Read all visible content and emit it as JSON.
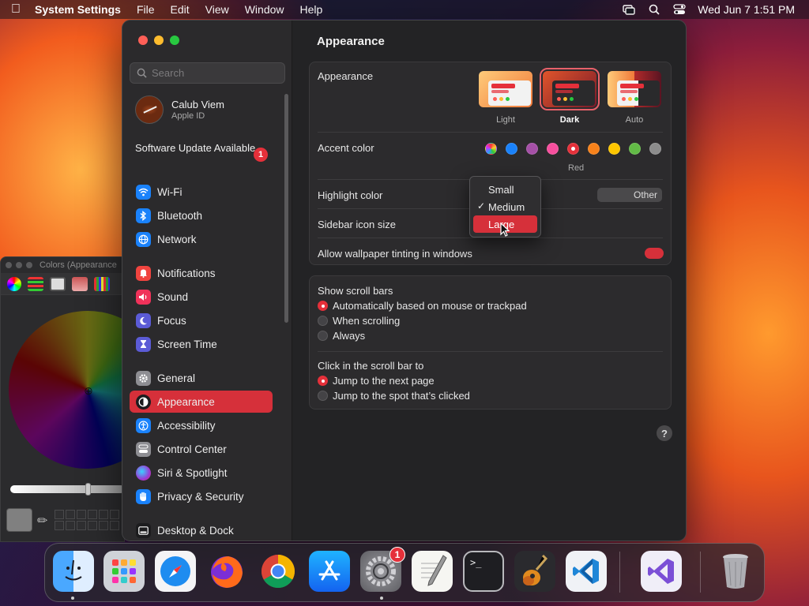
{
  "menubar": {
    "app_name": "System Settings",
    "items": [
      "File",
      "Edit",
      "View",
      "Window",
      "Help"
    ],
    "clock": "Wed Jun 7  1:51 PM"
  },
  "colors_panel": {
    "title": "Colors (Appearance"
  },
  "sidebar": {
    "search_placeholder": "Search",
    "account": {
      "name": "Calub Viem",
      "subtitle": "Apple ID"
    },
    "update": {
      "label": "Software Update Available",
      "badge": "1"
    },
    "items": [
      {
        "label": "Wi-Fi",
        "icon": "wifi-icon",
        "color": "#1a82fb"
      },
      {
        "label": "Bluetooth",
        "icon": "bluetooth-icon",
        "color": "#1a82fb"
      },
      {
        "label": "Network",
        "icon": "globe-icon",
        "color": "#1a82fb"
      },
      {
        "label": "Notifications",
        "icon": "bell-icon",
        "color": "#f0443f"
      },
      {
        "label": "Sound",
        "icon": "speaker-icon",
        "color": "#f0325a"
      },
      {
        "label": "Focus",
        "icon": "moon-icon",
        "color": "#5b5bd6"
      },
      {
        "label": "Screen Time",
        "icon": "hourglass-icon",
        "color": "#5b5bd6"
      },
      {
        "label": "General",
        "icon": "gear-icon",
        "color": "#8e8e93"
      },
      {
        "label": "Appearance",
        "icon": "appearance-icon",
        "color": "#1c1c1e"
      },
      {
        "label": "Accessibility",
        "icon": "accessibility-icon",
        "color": "#1a82fb"
      },
      {
        "label": "Control Center",
        "icon": "toggles-icon",
        "color": "#8e8e93"
      },
      {
        "label": "Siri & Spotlight",
        "icon": "siri-icon",
        "color": "#9b3bd6"
      },
      {
        "label": "Privacy & Security",
        "icon": "hand-icon",
        "color": "#1a82fb"
      },
      {
        "label": "Desktop & Dock",
        "icon": "dock-icon",
        "color": "#1c1c1e"
      }
    ],
    "selected": "Appearance"
  },
  "main": {
    "title": "Appearance",
    "appearance": {
      "label": "Appearance",
      "options": [
        "Light",
        "Dark",
        "Auto"
      ],
      "selected": "Dark"
    },
    "accent": {
      "label": "Accent color",
      "colors": [
        "multicolor",
        "#1a82fb",
        "#a550a7",
        "#f74f9e",
        "#e5303a",
        "#f7821b",
        "#ffc600",
        "#62ba46",
        "#8c8c8c"
      ],
      "selected_name": "Red"
    },
    "highlight": {
      "label": "Highlight color",
      "value": "Other"
    },
    "sidebar_icon_size": {
      "label": "Sidebar icon size",
      "options": [
        "Small",
        "Medium",
        "Large"
      ],
      "checked": "Medium",
      "hovered": "Large"
    },
    "wallpaper_tinting": {
      "label": "Allow wallpaper tinting in windows",
      "on": true
    },
    "scroll_bars": {
      "label": "Show scroll bars",
      "options": [
        "Automatically based on mouse or trackpad",
        "When scrolling",
        "Always"
      ],
      "selected": 0
    },
    "click_scroll": {
      "label": "Click in the scroll bar to",
      "options": [
        "Jump to the next page",
        "Jump to the spot that’s clicked"
      ],
      "selected": 0
    },
    "help": "?"
  },
  "dock": {
    "apps": [
      "finder-icon",
      "launchpad-icon",
      "safari-icon",
      "firefox-icon",
      "chrome-icon",
      "app-store-icon",
      "system-settings-icon",
      "textedit-icon",
      "terminal-icon",
      "garageband-icon",
      "vscode-icon",
      "visual-studio-icon",
      "trash-icon"
    ],
    "settings_badge": "1"
  }
}
